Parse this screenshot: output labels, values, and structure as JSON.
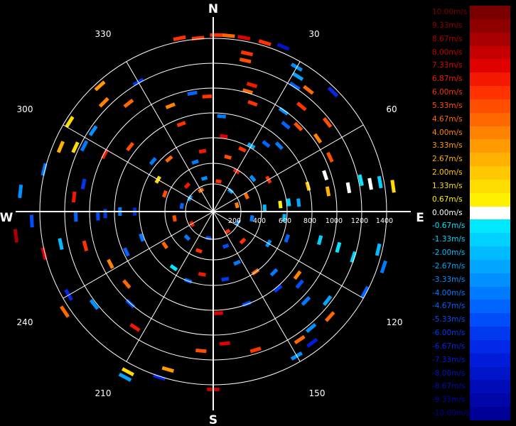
{
  "chart_data": {
    "type": "polar-radar",
    "title": "",
    "compass_labels": [
      "N",
      "E",
      "S",
      "W"
    ],
    "azimuth_labels": [
      "30",
      "60",
      "120",
      "150",
      "210",
      "240",
      "300",
      "330"
    ],
    "range_ticks": [
      "200",
      "400",
      "600",
      "800",
      "1000",
      "1200",
      "1400"
    ],
    "range_max": 1500,
    "grid": true,
    "legend_position": "right",
    "legend": [
      {
        "label": "10.00m/s",
        "color": "#7a0000"
      },
      {
        "label": "9.33m/s",
        "color": "#8e0000"
      },
      {
        "label": "8.67m/s",
        "color": "#a80000"
      },
      {
        "label": "8.00m/s",
        "color": "#c40000"
      },
      {
        "label": "7.33m/s",
        "color": "#e00000"
      },
      {
        "label": "6.87m/s",
        "color": "#f51800"
      },
      {
        "label": "6.00m/s",
        "color": "#ff3200"
      },
      {
        "label": "5.33m/s",
        "color": "#ff4e00"
      },
      {
        "label": "4.67m/s",
        "color": "#ff6800"
      },
      {
        "label": "4.00m/s",
        "color": "#ff8200"
      },
      {
        "label": "3.33m/s",
        "color": "#ff9a00"
      },
      {
        "label": "2.67m/s",
        "color": "#ffb000"
      },
      {
        "label": "2.00m/s",
        "color": "#ffc800"
      },
      {
        "label": "1.33m/s",
        "color": "#ffdc00"
      },
      {
        "label": "0.67m/s",
        "color": "#fff000"
      },
      {
        "label": "0.00m/s",
        "color": "#ffffff"
      },
      {
        "label": "-0.67m/s",
        "color": "#00e8ff"
      },
      {
        "label": "-1.33m/s",
        "color": "#00d2ff"
      },
      {
        "label": "-2.00m/s",
        "color": "#00bcff"
      },
      {
        "label": "-2.67m/s",
        "color": "#00a6ff"
      },
      {
        "label": "-3.33m/s",
        "color": "#0090ff"
      },
      {
        "label": "-4.00m/s",
        "color": "#007aff"
      },
      {
        "label": "-4.67m/s",
        "color": "#0064ff"
      },
      {
        "label": "-5.33m/s",
        "color": "#004efa"
      },
      {
        "label": "-6.00m/s",
        "color": "#0038f0"
      },
      {
        "label": "-6.67m/s",
        "color": "#0028e6"
      },
      {
        "label": "-7.33m/s",
        "color": "#001cd8"
      },
      {
        "label": "-8.00m/s",
        "color": "#0014c8"
      },
      {
        "label": "-8.67m/s",
        "color": "#000cb8"
      },
      {
        "label": "-9.33m/s",
        "color": "#0006a8"
      },
      {
        "label": "-10.00m/s",
        "color": "#000098"
      }
    ],
    "velocity_bins": [
      {
        "azimuth": 1,
        "range": 1440,
        "velocity": 6.0
      },
      {
        "azimuth": 5,
        "range": 1440,
        "velocity": 4.67
      },
      {
        "azimuth": 10,
        "range": 1440,
        "velocity": 7.33
      },
      {
        "azimuth": 17,
        "range": 1440,
        "velocity": 6.0
      },
      {
        "azimuth": 23,
        "range": 1460,
        "velocity": -8.0
      },
      {
        "azimuth": 355,
        "range": 1420,
        "velocity": 6.0
      },
      {
        "azimuth": 349,
        "range": 1440,
        "velocity": 6.0
      },
      {
        "azimuth": 12,
        "range": 1320,
        "velocity": 6.0
      },
      {
        "azimuth": 12,
        "range": 1260,
        "velocity": 5.33
      },
      {
        "azimuth": 17,
        "range": 1080,
        "velocity": 6.87
      },
      {
        "azimuth": 16,
        "range": 1020,
        "velocity": 4.67
      },
      {
        "azimuth": 30,
        "range": 1360,
        "velocity": -3.33
      },
      {
        "azimuth": 32,
        "range": 1300,
        "velocity": -2.67
      },
      {
        "azimuth": 33,
        "range": 1220,
        "velocity": -4.67
      },
      {
        "azimuth": 38,
        "range": 1260,
        "velocity": 4.67
      },
      {
        "azimuth": 45,
        "range": 1380,
        "velocity": -6.67
      },
      {
        "azimuth": 40,
        "range": 1120,
        "velocity": 6.0
      },
      {
        "azimuth": 52,
        "range": 1180,
        "velocity": 5.33
      },
      {
        "azimuth": 35,
        "range": 1000,
        "velocity": -3.33
      },
      {
        "azimuth": 40,
        "range": 920,
        "velocity": -4.67
      },
      {
        "azimuth": 45,
        "range": 980,
        "velocity": 5.33
      },
      {
        "azimuth": 55,
        "range": 1040,
        "velocity": 4.0
      },
      {
        "azimuth": 65,
        "range": 1050,
        "velocity": 5.33
      },
      {
        "azimuth": 45,
        "range": 760,
        "velocity": -4.0
      },
      {
        "azimuth": 38,
        "range": 700,
        "velocity": -4.67
      },
      {
        "azimuth": 30,
        "range": 620,
        "velocity": -2.67
      },
      {
        "azimuth": 25,
        "range": 560,
        "velocity": 6.0
      },
      {
        "azimuth": 72,
        "range": 960,
        "velocity": 0.0
      },
      {
        "azimuth": 75,
        "range": 800,
        "velocity": 2.0
      },
      {
        "azimuth": 80,
        "range": 1120,
        "velocity": 0.0
      },
      {
        "azimuth": 80,
        "range": 1300,
        "velocity": 0.0
      },
      {
        "azimuth": 82,
        "range": 1480,
        "velocity": 1.33
      },
      {
        "azimuth": 80,
        "range": 1380,
        "velocity": -1.33
      },
      {
        "azimuth": 78,
        "range": 1230,
        "velocity": -0.67
      },
      {
        "azimuth": 80,
        "range": 950,
        "velocity": 2.67
      },
      {
        "azimuth": 84,
        "range": 700,
        "velocity": -2.67
      },
      {
        "azimuth": 84,
        "range": 550,
        "velocity": 0.67
      },
      {
        "azimuth": 83,
        "range": 620,
        "velocity": -1.33
      },
      {
        "azimuth": 86,
        "range": 420,
        "velocity": -2.0
      },
      {
        "azimuth": 106,
        "range": 1060,
        "velocity": -0.67
      },
      {
        "azimuth": 105,
        "range": 900,
        "velocity": -1.33
      },
      {
        "azimuth": 108,
        "range": 1200,
        "velocity": -1.33
      },
      {
        "azimuth": 103,
        "range": 1380,
        "velocity": -2.0
      },
      {
        "azimuth": 108,
        "range": 1460,
        "velocity": -4.0
      },
      {
        "azimuth": 118,
        "range": 1400,
        "velocity": -4.67
      },
      {
        "azimuth": 128,
        "range": 1180,
        "velocity": -2.67
      },
      {
        "azimuth": 132,
        "range": 1280,
        "velocity": 4.67
      },
      {
        "azimuth": 140,
        "range": 1240,
        "velocity": -3.33
      },
      {
        "azimuth": 143,
        "range": 1340,
        "velocity": -7.33
      },
      {
        "azimuth": 146,
        "range": 1260,
        "velocity": 4.67
      },
      {
        "azimuth": 150,
        "range": 1360,
        "velocity": -3.33
      },
      {
        "azimuth": 134,
        "range": 1050,
        "velocity": -4.0
      },
      {
        "azimuth": 130,
        "range": 920,
        "velocity": -5.33
      },
      {
        "azimuth": 127,
        "range": 860,
        "velocity": 4.0
      },
      {
        "azimuth": 135,
        "range": 700,
        "velocity": -4.0
      },
      {
        "azimuth": 145,
        "range": 600,
        "velocity": 4.67
      },
      {
        "azimuth": 140,
        "range": 820,
        "velocity": -6.0
      },
      {
        "azimuth": 160,
        "range": 800,
        "velocity": -5.33
      },
      {
        "azimuth": 163,
        "range": 1180,
        "velocity": 6.0
      },
      {
        "azimuth": 175,
        "range": 1080,
        "velocity": 7.33
      },
      {
        "azimuth": 177,
        "range": 830,
        "velocity": 7.33
      },
      {
        "azimuth": 180,
        "range": 1450,
        "velocity": 8.0
      },
      {
        "azimuth": 185,
        "range": 1140,
        "velocity": 5.33
      },
      {
        "azimuth": 196,
        "range": 1340,
        "velocity": 3.33
      },
      {
        "azimuth": 198,
        "range": 1420,
        "velocity": -6.67
      },
      {
        "azimuth": 208,
        "range": 1480,
        "velocity": 1.33
      },
      {
        "azimuth": 208,
        "range": 1530,
        "velocity": -2.67
      },
      {
        "azimuth": 214,
        "range": 1140,
        "velocity": 6.87
      },
      {
        "azimuth": 222,
        "range": 1010,
        "velocity": -5.33
      },
      {
        "azimuth": 230,
        "range": 920,
        "velocity": 4.67
      },
      {
        "azimuth": 232,
        "range": 1230,
        "velocity": -3.33
      },
      {
        "azimuth": 236,
        "range": 1460,
        "velocity": 4.67
      },
      {
        "azimuth": 240,
        "range": 1360,
        "velocity": -6.67
      },
      {
        "azimuth": 245,
        "range": 780,
        "velocity": -4.67
      },
      {
        "azimuth": 243,
        "range": 940,
        "velocity": 4.0
      },
      {
        "azimuth": 258,
        "range": 1270,
        "velocity": -2.0
      },
      {
        "azimuth": 256,
        "range": 1420,
        "velocity": 7.33
      },
      {
        "azimuth": 255,
        "range": 1080,
        "velocity": 6.0
      },
      {
        "azimuth": 263,
        "range": 1620,
        "velocity": 8.67
      },
      {
        "azimuth": 267,
        "range": 1480,
        "velocity": -5.33
      },
      {
        "azimuth": 268,
        "range": 1120,
        "velocity": -4.67
      },
      {
        "azimuth": 268,
        "range": 940,
        "velocity": -5.33
      },
      {
        "azimuth": 269,
        "range": 880,
        "velocity": -6.0
      },
      {
        "azimuth": 270,
        "range": 760,
        "velocity": -4.0
      },
      {
        "azimuth": 270,
        "range": 640,
        "velocity": -6.67
      },
      {
        "azimuth": 276,
        "range": 1140,
        "velocity": 6.87
      },
      {
        "azimuth": 276,
        "range": 1580,
        "velocity": -3.33
      },
      {
        "azimuth": 282,
        "range": 1080,
        "velocity": -6.0
      },
      {
        "azimuth": 284,
        "range": 1420,
        "velocity": -4.0
      },
      {
        "azimuth": 293,
        "range": 1350,
        "velocity": 2.67
      },
      {
        "azimuth": 295,
        "range": 1240,
        "velocity": 1.33
      },
      {
        "azimuth": 297,
        "range": 1180,
        "velocity": -4.0
      },
      {
        "azimuth": 302,
        "range": 1380,
        "velocity": 1.33
      },
      {
        "azimuth": 298,
        "range": 1000,
        "velocity": 6.87
      },
      {
        "azimuth": 304,
        "range": 1180,
        "velocity": -3.33
      },
      {
        "azimuth": 308,
        "range": 860,
        "velocity": 5.33
      },
      {
        "azimuth": 315,
        "range": 1260,
        "velocity": 4.0
      },
      {
        "azimuth": 318,
        "range": 1380,
        "velocity": 3.33
      },
      {
        "azimuth": 322,
        "range": 1120,
        "velocity": 4.67
      },
      {
        "azimuth": 330,
        "range": 1220,
        "velocity": -6.0
      },
      {
        "azimuth": 338,
        "range": 930,
        "velocity": 4.0
      },
      {
        "azimuth": 340,
        "range": 760,
        "velocity": 6.0
      },
      {
        "azimuth": 350,
        "range": 980,
        "velocity": -4.67
      },
      {
        "azimuth": 357,
        "range": 940,
        "velocity": 6.0
      },
      {
        "azimuth": 8,
        "range": 620,
        "velocity": 7.33
      },
      {
        "azimuth": 20,
        "range": 940,
        "velocity": 6.0
      },
      {
        "azimuth": 5,
        "range": 780,
        "velocity": -4.0
      },
      {
        "azimuth": 15,
        "range": 460,
        "velocity": 5.33
      },
      {
        "azimuth": 350,
        "range": 500,
        "velocity": 6.87
      },
      {
        "azimuth": 340,
        "range": 430,
        "velocity": -4.0
      },
      {
        "azimuth": 320,
        "range": 560,
        "velocity": 4.67
      },
      {
        "azimuth": 310,
        "range": 640,
        "velocity": -4.0
      },
      {
        "azimuth": 300,
        "range": 520,
        "velocity": 1.33
      },
      {
        "azimuth": 290,
        "range": 420,
        "velocity": 5.33
      },
      {
        "azimuth": 250,
        "range": 620,
        "velocity": -4.0
      },
      {
        "azimuth": 235,
        "range": 480,
        "velocity": 4.67
      },
      {
        "azimuth": 215,
        "range": 560,
        "velocity": -0.67
      },
      {
        "azimuth": 200,
        "range": 600,
        "velocity": -4.67
      },
      {
        "azimuth": 190,
        "range": 520,
        "velocity": 6.87
      },
      {
        "azimuth": 170,
        "range": 560,
        "velocity": -6.0
      },
      {
        "azimuth": 155,
        "range": 460,
        "velocity": -4.0
      },
      {
        "azimuth": 120,
        "range": 520,
        "velocity": -3.33
      },
      {
        "azimuth": 110,
        "range": 640,
        "velocity": -4.67
      },
      {
        "azimuth": 95,
        "range": 580,
        "velocity": -2.0
      },
      {
        "azimuth": 60,
        "range": 520,
        "velocity": 6.0
      },
      {
        "azimuth": 50,
        "range": 420,
        "velocity": -3.33
      },
      {
        "azimuth": 30,
        "range": 380,
        "velocity": 6.87
      },
      {
        "azimuth": 65,
        "range": 300,
        "velocity": 4.67
      },
      {
        "azimuth": 100,
        "range": 320,
        "velocity": -4.0
      },
      {
        "azimuth": 135,
        "range": 340,
        "velocity": 6.0
      },
      {
        "azimuth": 160,
        "range": 300,
        "velocity": -5.33
      },
      {
        "azimuth": 200,
        "range": 340,
        "velocity": 6.0
      },
      {
        "azimuth": 225,
        "range": 300,
        "velocity": -4.0
      },
      {
        "azimuth": 260,
        "range": 320,
        "velocity": 5.33
      },
      {
        "azimuth": 280,
        "range": 260,
        "velocity": -4.67
      },
      {
        "azimuth": 315,
        "range": 300,
        "velocity": 6.87
      },
      {
        "azimuth": 345,
        "range": 280,
        "velocity": -3.33
      },
      {
        "azimuth": 10,
        "range": 250,
        "velocity": 6.0
      },
      {
        "azimuth": 40,
        "range": 220,
        "velocity": -2.67
      },
      {
        "azimuth": 75,
        "range": 200,
        "velocity": 4.0
      },
      {
        "azimuth": 115,
        "range": 220,
        "velocity": -4.0
      },
      {
        "azimuth": 145,
        "range": 200,
        "velocity": 6.0
      },
      {
        "azimuth": 190,
        "range": 220,
        "velocity": -5.33
      },
      {
        "azimuth": 240,
        "range": 200,
        "velocity": 6.87
      },
      {
        "azimuth": 300,
        "range": 220,
        "velocity": -3.33
      },
      {
        "azimuth": 330,
        "range": 200,
        "velocity": 4.67
      }
    ]
  }
}
